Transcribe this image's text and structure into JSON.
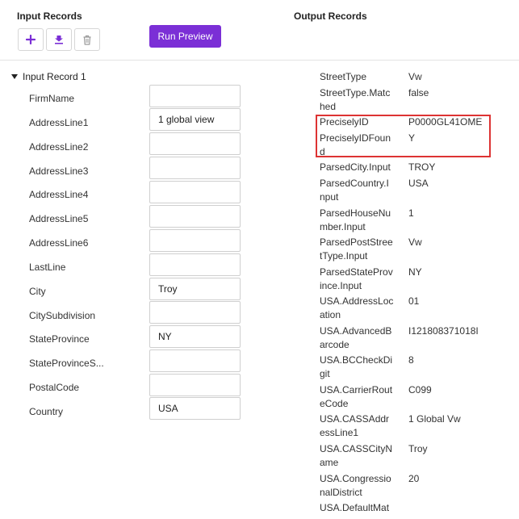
{
  "input_header": "Input Records",
  "output_header": "Output Records",
  "toolbar": {
    "add_icon": "plus-icon",
    "import_icon": "download-icon",
    "delete_icon": "trash-icon",
    "run_label": "Run Preview"
  },
  "record": {
    "label": "Input Record 1"
  },
  "fields": [
    {
      "label": "FirmName",
      "value": ""
    },
    {
      "label": "AddressLine1",
      "value": "1 global view"
    },
    {
      "label": "AddressLine2",
      "value": ""
    },
    {
      "label": "AddressLine3",
      "value": ""
    },
    {
      "label": "AddressLine4",
      "value": ""
    },
    {
      "label": "AddressLine5",
      "value": ""
    },
    {
      "label": "AddressLine6",
      "value": ""
    },
    {
      "label": "LastLine",
      "value": ""
    },
    {
      "label": "City",
      "value": "Troy"
    },
    {
      "label": "CitySubdivision",
      "value": ""
    },
    {
      "label": "StateProvince",
      "value": "NY"
    },
    {
      "label": "StateProvinceS...",
      "value": ""
    },
    {
      "label": "PostalCode",
      "value": ""
    },
    {
      "label": "Country",
      "value": "USA"
    }
  ],
  "outputs": [
    {
      "key": "StreetType",
      "value": "Vw"
    },
    {
      "key": "StreetType.Matched",
      "value": "false"
    },
    {
      "key": "PreciselyID",
      "value": "P0000GL41OME"
    },
    {
      "key": "PreciselyIDFound",
      "value": "Y"
    },
    {
      "key": "ParsedCity.Input",
      "value": "TROY"
    },
    {
      "key": "ParsedCountry.Input",
      "value": "USA"
    },
    {
      "key": "ParsedHouseNumber.Input",
      "value": "1"
    },
    {
      "key": "ParsedPostStreetType.Input",
      "value": "Vw"
    },
    {
      "key": "ParsedStateProvince.Input",
      "value": "NY"
    },
    {
      "key": "USA.AddressLocation",
      "value": "01"
    },
    {
      "key": "USA.AdvancedBarcode",
      "value": "I121808371018I"
    },
    {
      "key": "USA.BCCheckDigit",
      "value": "8"
    },
    {
      "key": "USA.CarrierRouteCode",
      "value": "C099"
    },
    {
      "key": "USA.CASSAddressLine1",
      "value": "1 Global Vw"
    },
    {
      "key": "USA.CASSCityName",
      "value": "Troy"
    },
    {
      "key": "USA.CongressionalDistrict",
      "value": "20"
    },
    {
      "key": "USA.DefaultMat",
      "value": ""
    }
  ],
  "colors": {
    "accent": "#7b2fd6",
    "highlight": "#dd3333"
  }
}
